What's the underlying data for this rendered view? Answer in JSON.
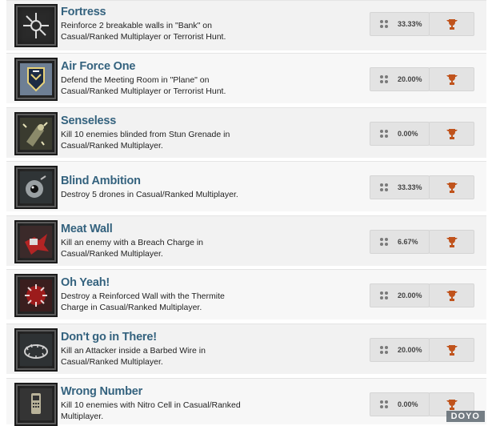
{
  "achievements": [
    {
      "title": "Fortress",
      "desc": "Reinforce 2 breakable walls in \"Bank\" on Casual/Ranked Multiplayer or Terrorist Hunt.",
      "percent": "33.33%",
      "icon": "fortress-icon"
    },
    {
      "title": "Air Force One",
      "desc": "Defend the Meeting Room in \"Plane\" on Casual/Ranked Multiplayer or Terrorist Hunt.",
      "percent": "20.00%",
      "icon": "air-force-one-icon"
    },
    {
      "title": "Senseless",
      "desc": "Kill 10 enemies blinded from Stun Grenade in Casual/Ranked Multiplayer.",
      "percent": "0.00%",
      "icon": "senseless-icon"
    },
    {
      "title": "Blind Ambition",
      "desc": "Destroy 5 drones in Casual/Ranked Multiplayer.",
      "percent": "33.33%",
      "icon": "blind-ambition-icon"
    },
    {
      "title": "Meat Wall",
      "desc": "Kill an enemy with a Breach Charge in Casual/Ranked Multiplayer.",
      "percent": "6.67%",
      "icon": "meat-wall-icon"
    },
    {
      "title": "Oh Yeah!",
      "desc": "Destroy a Reinforced Wall with the Thermite Charge in Casual/Ranked Multiplayer.",
      "percent": "20.00%",
      "icon": "oh-yeah-icon"
    },
    {
      "title": "Don't go in There!",
      "desc": "Kill an Attacker inside a Barbed Wire in Casual/Ranked Multiplayer.",
      "percent": "20.00%",
      "icon": "barbed-wire-icon"
    },
    {
      "title": "Wrong Number",
      "desc": "Kill 10 enemies with Nitro Cell in Casual/Ranked Multiplayer.",
      "percent": "0.00%",
      "icon": "wrong-number-icon"
    }
  ],
  "colors": {
    "title": "#34627e",
    "trophy": "#c0531c"
  },
  "watermark": "DOYO"
}
